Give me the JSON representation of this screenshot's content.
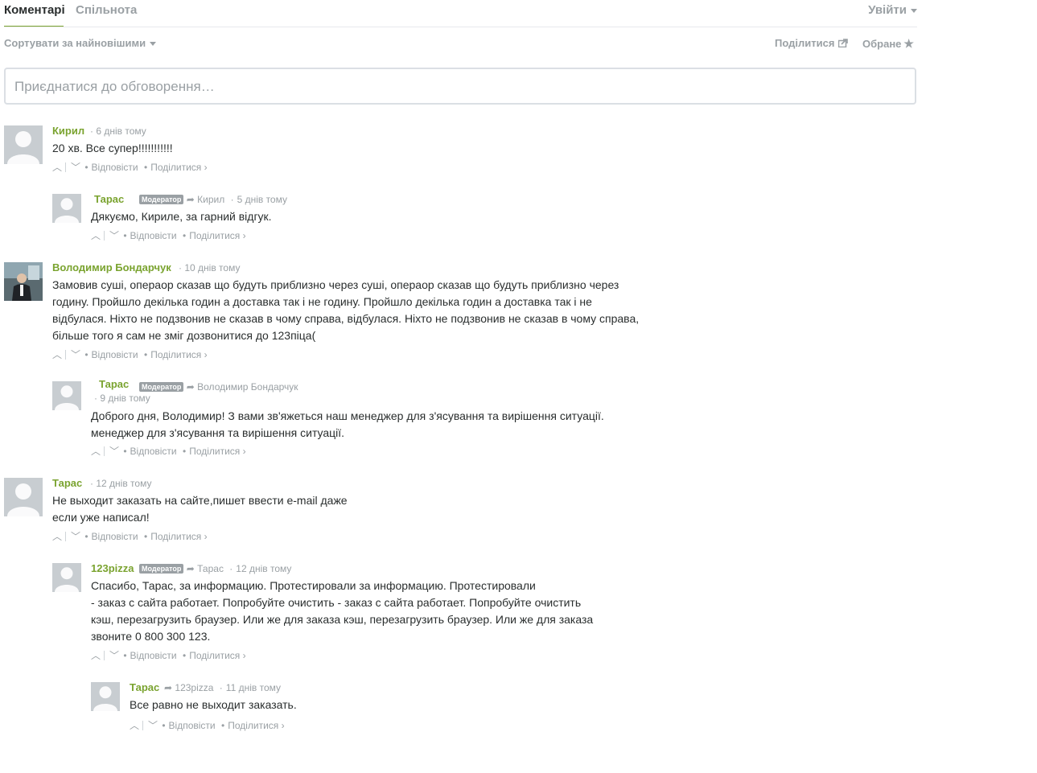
{
  "header": {
    "tab_comments": "Коментарі",
    "tab_community": "Спільнота",
    "login": "Увійти"
  },
  "toolbar": {
    "sort": "Сортувати за найновішими",
    "share": "Поділитися",
    "favorite": "Обране"
  },
  "compose": {
    "placeholder": "Приєднатися до обговорення…"
  },
  "actions": {
    "reply": "Відповісти",
    "share": "Поділитися ›"
  },
  "moderator_badge": "Модератор",
  "comments": [
    {
      "author": "Кирил",
      "time": "6 днів тому",
      "lines": [
        "20 хв. Все супер!!!!!!!!!!!"
      ]
    },
    {
      "author": "Тарас",
      "reply_to": "Кирил",
      "time": "5 днів тому",
      "lines": [
        "Дякуємо, Кириле, за гарний відгук."
      ]
    },
    {
      "author": "Володимир Бондарчук",
      "time": "10 днів тому",
      "lines": [
        "Замовив суші, операор сказав що будуть приблизно через суші, операор сказав що будуть приблизно через",
        "годину. Пройшло декілька годин а доставка так і не годину. Пройшло декілька годин а доставка так і не",
        "відбулася. Ніхто не подзвонив не сказав в чому справа, відбулася. Ніхто не подзвонив не сказав в чому справа,",
        "більше того я сам не зміг дозвонитися до 123піца("
      ]
    },
    {
      "author": "Тарас",
      "reply_to": "Володимир Бондарчук",
      "time": "9 днів тому",
      "lines": [
        "Доброго дня, Володимир! З вами зв'яжеться наш менеджер для з'ясування та вирішення ситуації.",
        "менеджер для з'ясування та вирішення ситуації."
      ]
    },
    {
      "author": "Тарас",
      "time": "12 днів тому",
      "lines": [
        "Не выходит заказать на сайте,пишет ввести e-mail даже",
        "если уже написал!"
      ]
    },
    {
      "author": "123pizza",
      "reply_to": "Тарас",
      "time": "12 днів тому",
      "lines": [
        "Спасибо, Тарас, за информацию. Протестировали  за информацию. Протестировали",
        "- заказ с сайта работает. Попробуйте очистить - заказ с сайта работает. Попробуйте очистить",
        "кэш, перезагрузить браузер. Или же для заказа  кэш, перезагрузить браузер. Или же для заказа",
        "звоните 0 800 300 123."
      ]
    },
    {
      "author": "Тарас",
      "reply_to": "123pizza",
      "time": "11 днів тому",
      "lines": [
        "Все равно не выходит заказать."
      ]
    }
  ]
}
